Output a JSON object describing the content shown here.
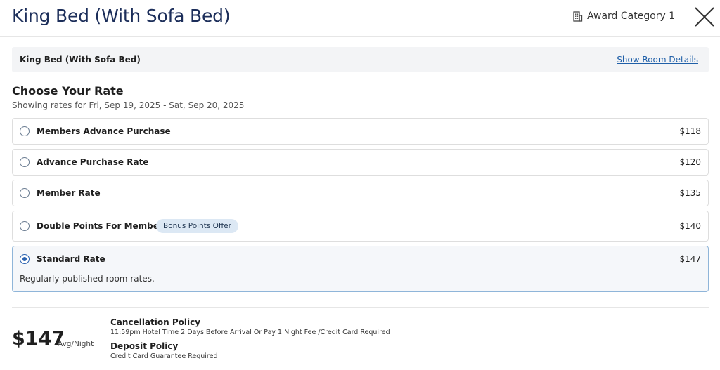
{
  "header": {
    "room_title": "King Bed (With Sofa Bed)",
    "award_category": "Award Category 1"
  },
  "room_bar": {
    "name": "King Bed (With Sofa Bed)",
    "details_link": "Show Room Details"
  },
  "rates_section": {
    "title": "Choose Your Rate",
    "dates": "Showing rates for Fri, Sep 19, 2025 - Sat, Sep 20, 2025"
  },
  "rates": [
    {
      "name": "Members Advance Purchase",
      "price": "$118",
      "selected": false
    },
    {
      "name": "Advance Purchase Rate",
      "price": "$120",
      "selected": false
    },
    {
      "name": "Member Rate",
      "price": "$135",
      "selected": false
    },
    {
      "name": "Double Points For Members",
      "price": "$140",
      "badge": "Bonus Points Offer",
      "selected": false
    },
    {
      "name": "Standard Rate",
      "price": "$147",
      "description": "Regularly published room rates.",
      "selected": true
    }
  ],
  "summary": {
    "price": "$147",
    "unit": "Avg/Night",
    "cancellation_title": "Cancellation Policy",
    "cancellation_text": "11:59pm Hotel Time 2 Days Before Arrival Or Pay 1 Night Fee /Credit Card Required",
    "deposit_title": "Deposit Policy",
    "deposit_text": "Credit Card Guarantee Required"
  },
  "colors": {
    "title_navy": "#1c2e5a",
    "link_blue": "#1f5fa8",
    "radio_selected": "#2a62b0",
    "badge_bg": "#dce8f4"
  },
  "icons": [
    "building-icon",
    "close-icon"
  ]
}
